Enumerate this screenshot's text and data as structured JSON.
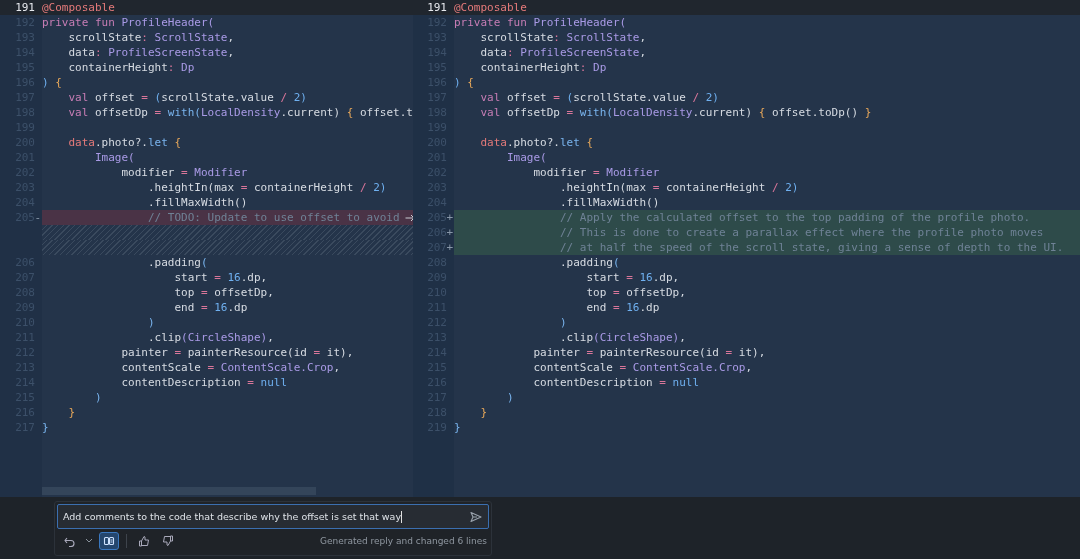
{
  "panes": [
    {
      "lines": [
        {
          "num": "191",
          "kind": "context",
          "current": true,
          "code": [
            {
              "kind": "annotation",
              "t": "@Composable"
            }
          ]
        },
        {
          "num": "192",
          "kind": "context",
          "current": false,
          "code": [
            {
              "kind": "keyword",
              "t": "private fun "
            },
            {
              "kind": "type",
              "t": "ProfileHeader("
            }
          ]
        },
        {
          "num": "193",
          "kind": "context",
          "current": false,
          "code": [
            {
              "kind": "plain",
              "t": "    scrollState"
            },
            {
              "kind": "operator",
              "t": ": "
            },
            {
              "kind": "type",
              "t": "ScrollState"
            },
            {
              "kind": "plain",
              "t": ","
            }
          ]
        },
        {
          "num": "194",
          "kind": "context",
          "current": false,
          "code": [
            {
              "kind": "plain",
              "t": "    data"
            },
            {
              "kind": "operator",
              "t": ": "
            },
            {
              "kind": "type",
              "t": "ProfileScreenState"
            },
            {
              "kind": "plain",
              "t": ","
            }
          ]
        },
        {
          "num": "195",
          "kind": "context",
          "current": false,
          "code": [
            {
              "kind": "plain",
              "t": "    containerHeight"
            },
            {
              "kind": "operator",
              "t": ": "
            },
            {
              "kind": "type",
              "t": "Dp"
            }
          ]
        },
        {
          "num": "196",
          "kind": "context",
          "current": false,
          "code": [
            {
              "kind": "number",
              "t": ") "
            },
            {
              "kind": "brace",
              "t": "{"
            }
          ]
        },
        {
          "num": "197",
          "kind": "context",
          "current": false,
          "code": [
            {
              "kind": "keyword",
              "t": "    val "
            },
            {
              "kind": "plain",
              "t": "offset "
            },
            {
              "kind": "operator",
              "t": "= "
            },
            {
              "kind": "number",
              "t": "("
            },
            {
              "kind": "plain",
              "t": "scrollState.value "
            },
            {
              "kind": "operator",
              "t": "/ "
            },
            {
              "kind": "number",
              "t": "2)"
            }
          ]
        },
        {
          "num": "198",
          "kind": "context",
          "current": false,
          "code": [
            {
              "kind": "keyword",
              "t": "    val "
            },
            {
              "kind": "plain",
              "t": "offsetDp "
            },
            {
              "kind": "operator",
              "t": "= "
            },
            {
              "kind": "call",
              "t": "with("
            },
            {
              "kind": "type",
              "t": "LocalDensity"
            },
            {
              "kind": "plain",
              "t": ".current) "
            },
            {
              "kind": "brace",
              "t": "{"
            },
            {
              "kind": "plain",
              "t": " offset.t"
            }
          ]
        },
        {
          "num": "199",
          "kind": "context",
          "current": false
        },
        {
          "num": "200",
          "kind": "context",
          "current": false,
          "code": [
            {
              "kind": "annotation",
              "t": "    data"
            },
            {
              "kind": "plain",
              "t": ".photo?."
            },
            {
              "kind": "call",
              "t": "let "
            },
            {
              "kind": "brace",
              "t": "{"
            }
          ]
        },
        {
          "num": "201",
          "kind": "context",
          "current": false,
          "code": [
            {
              "kind": "type",
              "t": "        Image("
            }
          ]
        },
        {
          "num": "202",
          "kind": "context",
          "current": false,
          "code": [
            {
              "kind": "plain",
              "t": "            modifier "
            },
            {
              "kind": "operator",
              "t": "= "
            },
            {
              "kind": "type",
              "t": "Modifier"
            }
          ]
        },
        {
          "num": "203",
          "kind": "context",
          "current": false,
          "code": [
            {
              "kind": "plain",
              "t": "                .heightIn(max "
            },
            {
              "kind": "operator",
              "t": "= "
            },
            {
              "kind": "plain",
              "t": "containerHeight "
            },
            {
              "kind": "operator",
              "t": "/ "
            },
            {
              "kind": "number",
              "t": "2)"
            }
          ]
        },
        {
          "num": "204",
          "kind": "context",
          "current": false,
          "code": [
            {
              "kind": "plain",
              "t": "                .fillMaxWidth()"
            }
          ]
        },
        {
          "num": "205",
          "kind": "deleted",
          "current": false,
          "marker": "-",
          "code": [
            {
              "kind": "comment",
              "t": "                // TODO: Update to use offset to avoid"
            }
          ]
        },
        {
          "kind": "filler",
          "current": false
        },
        {
          "kind": "filler",
          "current": false
        },
        {
          "num": "206",
          "kind": "context",
          "current": false,
          "code": [
            {
              "kind": "plain",
              "t": "                .padding"
            },
            {
              "kind": "call",
              "t": "("
            }
          ]
        },
        {
          "num": "207",
          "kind": "context",
          "current": false,
          "code": [
            {
              "kind": "plain",
              "t": "                    start "
            },
            {
              "kind": "operator",
              "t": "= "
            },
            {
              "kind": "number",
              "t": "16"
            },
            {
              "kind": "plain",
              "t": ".dp,"
            }
          ]
        },
        {
          "num": "208",
          "kind": "context",
          "current": false,
          "code": [
            {
              "kind": "plain",
              "t": "                    top "
            },
            {
              "kind": "operator",
              "t": "= "
            },
            {
              "kind": "plain",
              "t": "offsetDp,"
            }
          ]
        },
        {
          "num": "209",
          "kind": "context",
          "current": false,
          "code": [
            {
              "kind": "plain",
              "t": "                    end "
            },
            {
              "kind": "operator",
              "t": "= "
            },
            {
              "kind": "number",
              "t": "16"
            },
            {
              "kind": "plain",
              "t": ".dp"
            }
          ]
        },
        {
          "num": "210",
          "kind": "context",
          "current": false,
          "code": [
            {
              "kind": "call",
              "t": "                )"
            }
          ]
        },
        {
          "num": "211",
          "kind": "context",
          "current": false,
          "code": [
            {
              "kind": "plain",
              "t": "                .clip"
            },
            {
              "kind": "type",
              "t": "(CircleShape)"
            },
            {
              "kind": "plain",
              "t": ","
            }
          ]
        },
        {
          "num": "212",
          "kind": "context",
          "current": false,
          "code": [
            {
              "kind": "plain",
              "t": "            painter "
            },
            {
              "kind": "operator",
              "t": "= "
            },
            {
              "kind": "plain",
              "t": "painterResource(id "
            },
            {
              "kind": "operator",
              "t": "= "
            },
            {
              "kind": "plain",
              "t": "it),"
            }
          ]
        },
        {
          "num": "213",
          "kind": "context",
          "current": false,
          "code": [
            {
              "kind": "plain",
              "t": "            contentScale "
            },
            {
              "kind": "operator",
              "t": "= "
            },
            {
              "kind": "type",
              "t": "ContentScale.Crop"
            },
            {
              "kind": "plain",
              "t": ","
            }
          ]
        },
        {
          "num": "214",
          "kind": "context",
          "current": false,
          "code": [
            {
              "kind": "plain",
              "t": "            contentDescription "
            },
            {
              "kind": "operator",
              "t": "= "
            },
            {
              "kind": "number",
              "t": "null"
            }
          ]
        },
        {
          "num": "215",
          "kind": "context",
          "current": false,
          "code": [
            {
              "kind": "call",
              "t": "        )"
            }
          ]
        },
        {
          "num": "216",
          "kind": "context",
          "current": false,
          "code": [
            {
              "kind": "brace",
              "t": "    }"
            }
          ]
        },
        {
          "num": "217",
          "kind": "context",
          "current": false,
          "code": [
            {
              "kind": "call",
              "t": "}"
            }
          ]
        }
      ]
    },
    {
      "lines": [
        {
          "num": "191",
          "kind": "context",
          "current": true,
          "code": [
            {
              "kind": "annotation",
              "t": "@Composable"
            }
          ]
        },
        {
          "num": "192",
          "kind": "context",
          "current": false,
          "code": [
            {
              "kind": "keyword",
              "t": "private fun "
            },
            {
              "kind": "type",
              "t": "ProfileHeader("
            }
          ]
        },
        {
          "num": "193",
          "kind": "context",
          "current": false,
          "code": [
            {
              "kind": "plain",
              "t": "    scrollState"
            },
            {
              "kind": "operator",
              "t": ": "
            },
            {
              "kind": "type",
              "t": "ScrollState"
            },
            {
              "kind": "plain",
              "t": ","
            }
          ]
        },
        {
          "num": "194",
          "kind": "context",
          "current": false,
          "code": [
            {
              "kind": "plain",
              "t": "    data"
            },
            {
              "kind": "operator",
              "t": ": "
            },
            {
              "kind": "type",
              "t": "ProfileScreenState"
            },
            {
              "kind": "plain",
              "t": ","
            }
          ]
        },
        {
          "num": "195",
          "kind": "context",
          "current": false,
          "code": [
            {
              "kind": "plain",
              "t": "    containerHeight"
            },
            {
              "kind": "operator",
              "t": ": "
            },
            {
              "kind": "type",
              "t": "Dp"
            }
          ]
        },
        {
          "num": "196",
          "kind": "context",
          "current": false,
          "code": [
            {
              "kind": "number",
              "t": ") "
            },
            {
              "kind": "brace",
              "t": "{"
            }
          ]
        },
        {
          "num": "197",
          "kind": "context",
          "current": false,
          "code": [
            {
              "kind": "keyword",
              "t": "    val "
            },
            {
              "kind": "plain",
              "t": "offset "
            },
            {
              "kind": "operator",
              "t": "= "
            },
            {
              "kind": "number",
              "t": "("
            },
            {
              "kind": "plain",
              "t": "scrollState.value "
            },
            {
              "kind": "operator",
              "t": "/ "
            },
            {
              "kind": "number",
              "t": "2)"
            }
          ]
        },
        {
          "num": "198",
          "kind": "context",
          "current": false,
          "code": [
            {
              "kind": "keyword",
              "t": "    val "
            },
            {
              "kind": "plain",
              "t": "offsetDp "
            },
            {
              "kind": "operator",
              "t": "= "
            },
            {
              "kind": "call",
              "t": "with("
            },
            {
              "kind": "type",
              "t": "LocalDensity"
            },
            {
              "kind": "plain",
              "t": ".current) "
            },
            {
              "kind": "brace",
              "t": "{"
            },
            {
              "kind": "plain",
              "t": " offset.toDp() "
            },
            {
              "kind": "brace",
              "t": "}"
            }
          ]
        },
        {
          "num": "199",
          "kind": "context",
          "current": false
        },
        {
          "num": "200",
          "kind": "context",
          "current": false,
          "code": [
            {
              "kind": "annotation",
              "t": "    data"
            },
            {
              "kind": "plain",
              "t": ".photo?."
            },
            {
              "kind": "call",
              "t": "let "
            },
            {
              "kind": "brace",
              "t": "{"
            }
          ]
        },
        {
          "num": "201",
          "kind": "context",
          "current": false,
          "code": [
            {
              "kind": "type",
              "t": "        Image("
            }
          ]
        },
        {
          "num": "202",
          "kind": "context",
          "current": false,
          "code": [
            {
              "kind": "plain",
              "t": "            modifier "
            },
            {
              "kind": "operator",
              "t": "= "
            },
            {
              "kind": "type",
              "t": "Modifier"
            }
          ]
        },
        {
          "num": "203",
          "kind": "context",
          "current": false,
          "code": [
            {
              "kind": "plain",
              "t": "                .heightIn(max "
            },
            {
              "kind": "operator",
              "t": "= "
            },
            {
              "kind": "plain",
              "t": "containerHeight "
            },
            {
              "kind": "operator",
              "t": "/ "
            },
            {
              "kind": "number",
              "t": "2)"
            }
          ]
        },
        {
          "num": "204",
          "kind": "context",
          "current": false,
          "code": [
            {
              "kind": "plain",
              "t": "                .fillMaxWidth()"
            }
          ]
        },
        {
          "num": "205",
          "kind": "added",
          "current": false,
          "marker": "+",
          "code": [
            {
              "kind": "comment",
              "t": "                // Apply the calculated offset to the top padding of the profile photo."
            }
          ]
        },
        {
          "num": "206",
          "kind": "added",
          "current": false,
          "marker": "+",
          "code": [
            {
              "kind": "comment",
              "t": "                // This is done to create a parallax effect where the profile photo moves"
            }
          ]
        },
        {
          "num": "207",
          "kind": "added",
          "current": false,
          "marker": "+",
          "code": [
            {
              "kind": "comment",
              "t": "                // at half the speed of the scroll state, giving a sense of depth to the UI."
            }
          ]
        },
        {
          "num": "208",
          "kind": "context",
          "current": false,
          "code": [
            {
              "kind": "plain",
              "t": "                .padding"
            },
            {
              "kind": "call",
              "t": "("
            }
          ]
        },
        {
          "num": "209",
          "kind": "context",
          "current": false,
          "code": [
            {
              "kind": "plain",
              "t": "                    start "
            },
            {
              "kind": "operator",
              "t": "= "
            },
            {
              "kind": "number",
              "t": "16"
            },
            {
              "kind": "plain",
              "t": ".dp,"
            }
          ]
        },
        {
          "num": "210",
          "kind": "context",
          "current": false,
          "code": [
            {
              "kind": "plain",
              "t": "                    top "
            },
            {
              "kind": "operator",
              "t": "= "
            },
            {
              "kind": "plain",
              "t": "offsetDp,"
            }
          ]
        },
        {
          "num": "211",
          "kind": "context",
          "current": false,
          "code": [
            {
              "kind": "plain",
              "t": "                    end "
            },
            {
              "kind": "operator",
              "t": "= "
            },
            {
              "kind": "number",
              "t": "16"
            },
            {
              "kind": "plain",
              "t": ".dp"
            }
          ]
        },
        {
          "num": "212",
          "kind": "context",
          "current": false,
          "code": [
            {
              "kind": "call",
              "t": "                )"
            }
          ]
        },
        {
          "num": "213",
          "kind": "context",
          "current": false,
          "code": [
            {
              "kind": "plain",
              "t": "                .clip"
            },
            {
              "kind": "type",
              "t": "(CircleShape)"
            },
            {
              "kind": "plain",
              "t": ","
            }
          ]
        },
        {
          "num": "214",
          "kind": "context",
          "current": false,
          "code": [
            {
              "kind": "plain",
              "t": "            painter "
            },
            {
              "kind": "operator",
              "t": "= "
            },
            {
              "kind": "plain",
              "t": "painterResource(id "
            },
            {
              "kind": "operator",
              "t": "= "
            },
            {
              "kind": "plain",
              "t": "it),"
            }
          ]
        },
        {
          "num": "215",
          "kind": "context",
          "current": false,
          "code": [
            {
              "kind": "plain",
              "t": "            contentScale "
            },
            {
              "kind": "operator",
              "t": "= "
            },
            {
              "kind": "type",
              "t": "ContentScale.Crop"
            },
            {
              "kind": "plain",
              "t": ","
            }
          ]
        },
        {
          "num": "216",
          "kind": "context",
          "current": false,
          "code": [
            {
              "kind": "plain",
              "t": "            contentDescription "
            },
            {
              "kind": "operator",
              "t": "= "
            },
            {
              "kind": "number",
              "t": "null"
            }
          ]
        },
        {
          "num": "217",
          "kind": "context",
          "current": false,
          "code": [
            {
              "kind": "call",
              "t": "        )"
            }
          ]
        },
        {
          "num": "218",
          "kind": "context",
          "current": false,
          "code": [
            {
              "kind": "brace",
              "t": "    }"
            }
          ]
        },
        {
          "num": "219",
          "kind": "context",
          "current": false,
          "code": [
            {
              "kind": "call",
              "t": "}"
            }
          ]
        }
      ]
    }
  ],
  "prompt": {
    "value": "Add comments to the code that describe why the offset is set that way"
  },
  "toolbar": [
    {
      "kind": "undo"
    },
    {
      "kind": "dropdown"
    },
    {
      "kind": "diff",
      "selected": true
    },
    {
      "kind": "divider"
    },
    {
      "kind": "thumbs-up"
    },
    {
      "kind": "thumbs-down"
    }
  ],
  "status": "Generated reply and changed 6 lines"
}
